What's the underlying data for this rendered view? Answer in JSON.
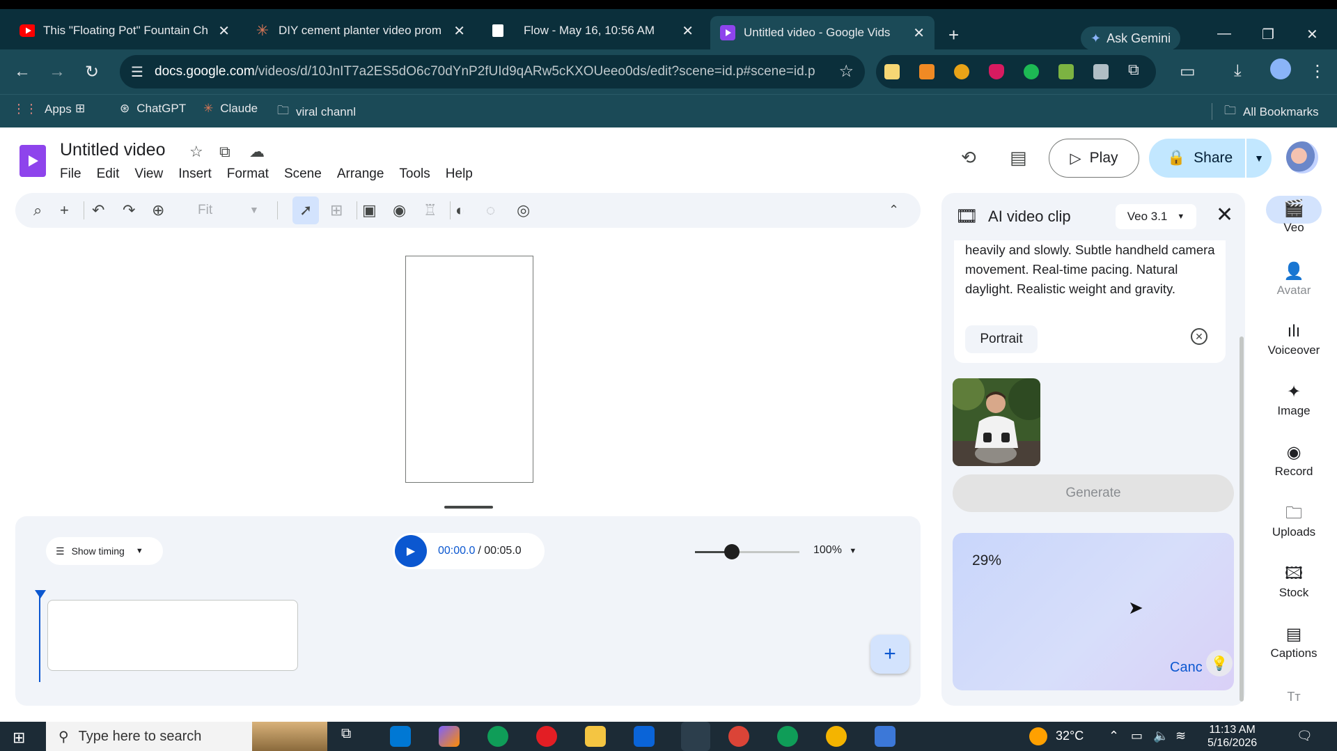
{
  "browser": {
    "tabs": [
      {
        "title": "This \"Floating Pot\" Fountain Ch",
        "favicon": "youtube-icon"
      },
      {
        "title": "DIY cement planter video prom",
        "favicon": "claude-icon"
      },
      {
        "title": "Flow - May 16, 10:56 AM",
        "favicon": "page-icon"
      },
      {
        "title": "Untitled video - Google Vids",
        "favicon": "vids-icon"
      }
    ],
    "ask_gemini": "Ask Gemini",
    "url_host": "docs.google.com",
    "url_rest": "/videos/d/10JnIT7a2ES5dO6c70dYnP2fUId9qARw5cKXOUeeo0ds/edit?scene=id.p#scene=id.p",
    "bookmarks": [
      "Apps",
      "ChatGPT",
      "Claude",
      "viral channl"
    ],
    "all_bookmarks": "All Bookmarks"
  },
  "app": {
    "title": "Untitled video",
    "menus": [
      "File",
      "Edit",
      "View",
      "Insert",
      "Format",
      "Scene",
      "Arrange",
      "Tools",
      "Help"
    ],
    "play": "Play",
    "share": "Share",
    "zoom_fit": "Fit"
  },
  "timeline": {
    "show_timing": "Show timing",
    "time_current": "00:00.0",
    "time_total": "/ 00:05.0",
    "zoom_percent": "100%",
    "zoom_level": 0.35
  },
  "ai_panel": {
    "title": "AI video clip",
    "model": "Veo 3.1",
    "prompt": "heavily and slowly. Subtle handheld camera movement. Real-time pacing. Natural daylight. Realistic weight and gravity.",
    "aspect_chip": "Portrait",
    "generate": "Generate",
    "progress": "29%",
    "cancel": "Cancel"
  },
  "rail": [
    {
      "label": "Veo",
      "icon": "veo-icon"
    },
    {
      "label": "Avatar",
      "icon": "avatar-icon"
    },
    {
      "label": "Voiceover",
      "icon": "voiceover-icon"
    },
    {
      "label": "Image",
      "icon": "image-icon"
    },
    {
      "label": "Record",
      "icon": "record-icon"
    },
    {
      "label": "Uploads",
      "icon": "folder-icon"
    },
    {
      "label": "Stock",
      "icon": "stock-icon"
    },
    {
      "label": "Captions",
      "icon": "captions-icon"
    }
  ],
  "taskbar": {
    "search_placeholder": "Type here to search",
    "temperature": "32°C",
    "time": "11:13 AM",
    "date": "5/16/2026"
  },
  "colors": {
    "accent": "#0b57d0",
    "chrome_dark": "#0b2f3b",
    "chrome": "#1b4a57",
    "share_bg": "#c2e7ff"
  }
}
